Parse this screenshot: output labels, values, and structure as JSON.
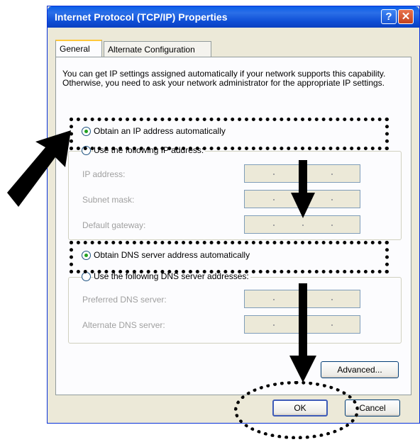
{
  "window": {
    "title": "Internet Protocol (TCP/IP) Properties",
    "help_label": "?",
    "close_label": "✕"
  },
  "tabs": [
    {
      "label": "General"
    },
    {
      "label": "Alternate Configuration"
    }
  ],
  "description": "You can get IP settings assigned automatically if your network supports this capability. Otherwise, you need to ask your network administrator for the appropriate IP settings.",
  "ip_section": {
    "auto_label": "Obtain an IP address automatically",
    "manual_label": "Use the following IP address:",
    "fields": [
      {
        "label": "IP address:"
      },
      {
        "label": "Subnet mask:"
      },
      {
        "label": "Default gateway:"
      }
    ]
  },
  "dns_section": {
    "auto_label": "Obtain DNS server address automatically",
    "manual_label": "Use the following DNS server addresses:",
    "fields": [
      {
        "label": "Preferred DNS server:"
      },
      {
        "label": "Alternate DNS server:"
      }
    ]
  },
  "buttons": {
    "advanced": "Advanced...",
    "ok": "OK",
    "cancel": "Cancel"
  },
  "colors": {
    "titlebar": "#0A5EE8",
    "dialog": "#ECE9D8",
    "radio_selected": "#21A121"
  }
}
